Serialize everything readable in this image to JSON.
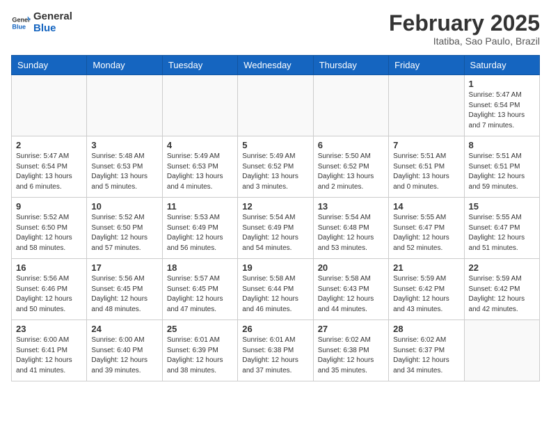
{
  "header": {
    "logo_general": "General",
    "logo_blue": "Blue",
    "month_title": "February 2025",
    "location": "Itatiba, Sao Paulo, Brazil"
  },
  "weekdays": [
    "Sunday",
    "Monday",
    "Tuesday",
    "Wednesday",
    "Thursday",
    "Friday",
    "Saturday"
  ],
  "weeks": [
    [
      {
        "day": "",
        "info": ""
      },
      {
        "day": "",
        "info": ""
      },
      {
        "day": "",
        "info": ""
      },
      {
        "day": "",
        "info": ""
      },
      {
        "day": "",
        "info": ""
      },
      {
        "day": "",
        "info": ""
      },
      {
        "day": "1",
        "info": "Sunrise: 5:47 AM\nSunset: 6:54 PM\nDaylight: 13 hours\nand 7 minutes."
      }
    ],
    [
      {
        "day": "2",
        "info": "Sunrise: 5:47 AM\nSunset: 6:54 PM\nDaylight: 13 hours\nand 6 minutes."
      },
      {
        "day": "3",
        "info": "Sunrise: 5:48 AM\nSunset: 6:53 PM\nDaylight: 13 hours\nand 5 minutes."
      },
      {
        "day": "4",
        "info": "Sunrise: 5:49 AM\nSunset: 6:53 PM\nDaylight: 13 hours\nand 4 minutes."
      },
      {
        "day": "5",
        "info": "Sunrise: 5:49 AM\nSunset: 6:52 PM\nDaylight: 13 hours\nand 3 minutes."
      },
      {
        "day": "6",
        "info": "Sunrise: 5:50 AM\nSunset: 6:52 PM\nDaylight: 13 hours\nand 2 minutes."
      },
      {
        "day": "7",
        "info": "Sunrise: 5:51 AM\nSunset: 6:51 PM\nDaylight: 13 hours\nand 0 minutes."
      },
      {
        "day": "8",
        "info": "Sunrise: 5:51 AM\nSunset: 6:51 PM\nDaylight: 12 hours\nand 59 minutes."
      }
    ],
    [
      {
        "day": "9",
        "info": "Sunrise: 5:52 AM\nSunset: 6:50 PM\nDaylight: 12 hours\nand 58 minutes."
      },
      {
        "day": "10",
        "info": "Sunrise: 5:52 AM\nSunset: 6:50 PM\nDaylight: 12 hours\nand 57 minutes."
      },
      {
        "day": "11",
        "info": "Sunrise: 5:53 AM\nSunset: 6:49 PM\nDaylight: 12 hours\nand 56 minutes."
      },
      {
        "day": "12",
        "info": "Sunrise: 5:54 AM\nSunset: 6:49 PM\nDaylight: 12 hours\nand 54 minutes."
      },
      {
        "day": "13",
        "info": "Sunrise: 5:54 AM\nSunset: 6:48 PM\nDaylight: 12 hours\nand 53 minutes."
      },
      {
        "day": "14",
        "info": "Sunrise: 5:55 AM\nSunset: 6:47 PM\nDaylight: 12 hours\nand 52 minutes."
      },
      {
        "day": "15",
        "info": "Sunrise: 5:55 AM\nSunset: 6:47 PM\nDaylight: 12 hours\nand 51 minutes."
      }
    ],
    [
      {
        "day": "16",
        "info": "Sunrise: 5:56 AM\nSunset: 6:46 PM\nDaylight: 12 hours\nand 50 minutes."
      },
      {
        "day": "17",
        "info": "Sunrise: 5:56 AM\nSunset: 6:45 PM\nDaylight: 12 hours\nand 48 minutes."
      },
      {
        "day": "18",
        "info": "Sunrise: 5:57 AM\nSunset: 6:45 PM\nDaylight: 12 hours\nand 47 minutes."
      },
      {
        "day": "19",
        "info": "Sunrise: 5:58 AM\nSunset: 6:44 PM\nDaylight: 12 hours\nand 46 minutes."
      },
      {
        "day": "20",
        "info": "Sunrise: 5:58 AM\nSunset: 6:43 PM\nDaylight: 12 hours\nand 44 minutes."
      },
      {
        "day": "21",
        "info": "Sunrise: 5:59 AM\nSunset: 6:42 PM\nDaylight: 12 hours\nand 43 minutes."
      },
      {
        "day": "22",
        "info": "Sunrise: 5:59 AM\nSunset: 6:42 PM\nDaylight: 12 hours\nand 42 minutes."
      }
    ],
    [
      {
        "day": "23",
        "info": "Sunrise: 6:00 AM\nSunset: 6:41 PM\nDaylight: 12 hours\nand 41 minutes."
      },
      {
        "day": "24",
        "info": "Sunrise: 6:00 AM\nSunset: 6:40 PM\nDaylight: 12 hours\nand 39 minutes."
      },
      {
        "day": "25",
        "info": "Sunrise: 6:01 AM\nSunset: 6:39 PM\nDaylight: 12 hours\nand 38 minutes."
      },
      {
        "day": "26",
        "info": "Sunrise: 6:01 AM\nSunset: 6:38 PM\nDaylight: 12 hours\nand 37 minutes."
      },
      {
        "day": "27",
        "info": "Sunrise: 6:02 AM\nSunset: 6:38 PM\nDaylight: 12 hours\nand 35 minutes."
      },
      {
        "day": "28",
        "info": "Sunrise: 6:02 AM\nSunset: 6:37 PM\nDaylight: 12 hours\nand 34 minutes."
      },
      {
        "day": "",
        "info": ""
      }
    ]
  ]
}
